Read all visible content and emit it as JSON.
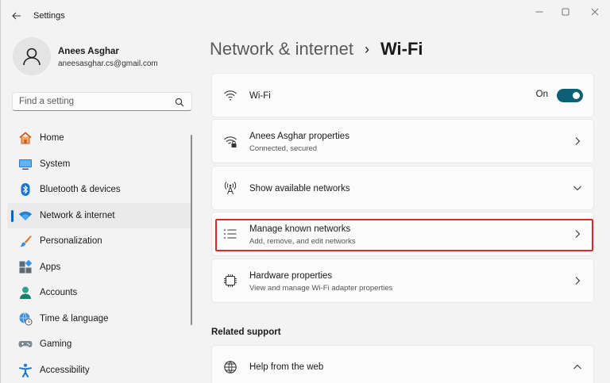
{
  "window": {
    "app_title": "Settings"
  },
  "user": {
    "name": "Anees Asghar",
    "email": "aneesasghar.cs@gmail.com"
  },
  "search": {
    "placeholder": "Find a setting"
  },
  "nav": {
    "items": [
      {
        "label": "Home",
        "icon": "home-icon",
        "selected": false
      },
      {
        "label": "System",
        "icon": "system-icon",
        "selected": false
      },
      {
        "label": "Bluetooth & devices",
        "icon": "bluetooth-icon",
        "selected": false
      },
      {
        "label": "Network & internet",
        "icon": "wifi-icon",
        "selected": true
      },
      {
        "label": "Personalization",
        "icon": "brush-icon",
        "selected": false
      },
      {
        "label": "Apps",
        "icon": "apps-icon",
        "selected": false
      },
      {
        "label": "Accounts",
        "icon": "accounts-icon",
        "selected": false
      },
      {
        "label": "Time & language",
        "icon": "globe-clock-icon",
        "selected": false
      },
      {
        "label": "Gaming",
        "icon": "gamepad-icon",
        "selected": false
      },
      {
        "label": "Accessibility",
        "icon": "accessibility-icon",
        "selected": false
      }
    ]
  },
  "breadcrumb": {
    "parent": "Network & internet",
    "separator": "›",
    "current": "Wi-Fi"
  },
  "cards": {
    "wifi": {
      "title": "Wi-Fi",
      "toggle_label": "On",
      "toggle_on": true
    },
    "properties": {
      "title": "Anees Asghar properties",
      "subtitle": "Connected, secured"
    },
    "available": {
      "title": "Show available networks"
    },
    "manage": {
      "title": "Manage known networks",
      "subtitle": "Add, remove, and edit networks",
      "highlighted": true
    },
    "hardware": {
      "title": "Hardware properties",
      "subtitle": "View and manage Wi-Fi adapter properties"
    },
    "help": {
      "title": "Help from the web"
    }
  },
  "related": {
    "heading": "Related support"
  },
  "colors": {
    "accent": "#0067c0",
    "toggle": "#0d5f73",
    "highlight": "#e1252b"
  }
}
